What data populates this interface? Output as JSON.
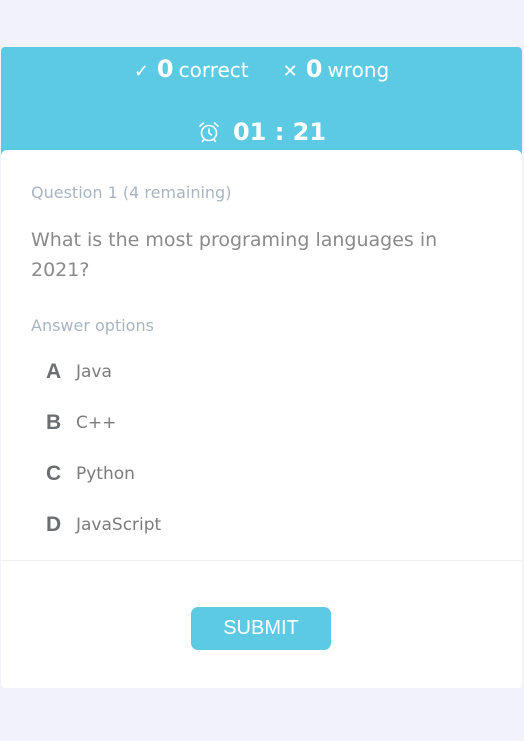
{
  "score": {
    "correct_icon": "checkmark-icon",
    "correct_count": "0",
    "correct_label": "correct",
    "wrong_icon": "cross-icon",
    "wrong_count": "0",
    "wrong_label": "wrong"
  },
  "timer": {
    "icon": "alarm-clock-icon",
    "value": "01 : 21"
  },
  "question": {
    "counter": "Question 1 (4 remaining)",
    "text": "What is the most programing languages in 2021?"
  },
  "answers": {
    "heading": "Answer options",
    "options": [
      {
        "letter": "A",
        "text": "Java"
      },
      {
        "letter": "B",
        "text": "C++"
      },
      {
        "letter": "C",
        "text": "Python"
      },
      {
        "letter": "D",
        "text": "JavaScript"
      }
    ]
  },
  "submit_label": "SUBMIT",
  "colors": {
    "accent": "#5ccae3",
    "page_background": "#f2f2fa",
    "muted_text": "#a9b5c0",
    "body_text": "#8a8a8a"
  }
}
